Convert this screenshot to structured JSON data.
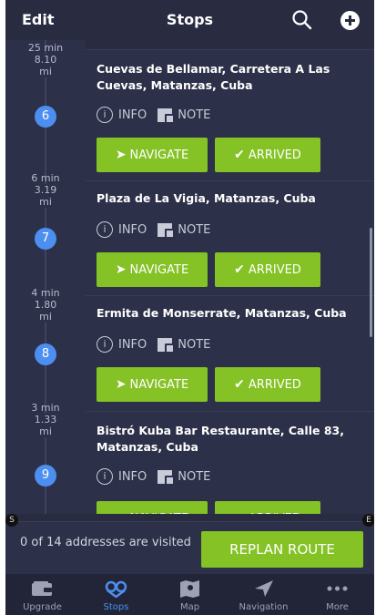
{
  "header": {
    "edit_label": "Edit",
    "title": "Stops"
  },
  "top_fragment": {
    "duration": "25 min"
  },
  "stops": [
    {
      "number": "6",
      "distance_top": "8.10",
      "distance_unit": "mi",
      "address": "Cuevas de Bellamar, Carretera A Las Cuevas, Matanzas, Cuba",
      "duration_next": "6 min"
    },
    {
      "number": "7",
      "distance_top": "3.19",
      "distance_unit": "mi",
      "address": "Plaza de La Vigia, Matanzas, Cuba",
      "duration_next": "4 min"
    },
    {
      "number": "8",
      "distance_top": "1.80",
      "distance_unit": "mi",
      "address": "Ermita de Monserrate, Matanzas, Cuba",
      "duration_next": "3 min"
    },
    {
      "number": "9",
      "distance_top": "1.33",
      "distance_unit": "mi",
      "address": "Bistró Kuba Bar Restaurante, Calle 83, Matanzas, Cuba",
      "duration_next": ""
    }
  ],
  "actions": {
    "info_label": "INFO",
    "note_label": "NOTE",
    "navigate_label": "NAVIGATE",
    "arrived_label": "ARRIVED"
  },
  "edge_markers": {
    "start": "S",
    "end": "E"
  },
  "footer": {
    "visited_text": "0 of 14 addresses are visited",
    "replan_label": "REPLAN ROUTE"
  },
  "tabs": [
    {
      "label": "Upgrade",
      "icon": "wallet-icon",
      "active": false
    },
    {
      "label": "Stops",
      "icon": "route-icon",
      "active": true
    },
    {
      "label": "Map",
      "icon": "map-icon",
      "active": false
    },
    {
      "label": "Navigation",
      "icon": "navigation-arrow-icon",
      "active": false
    },
    {
      "label": "More",
      "icon": "more-dots-icon",
      "active": false
    }
  ],
  "colors": {
    "background": "#292c41",
    "accent_green": "#84c225",
    "accent_blue": "#4d8ff0"
  }
}
